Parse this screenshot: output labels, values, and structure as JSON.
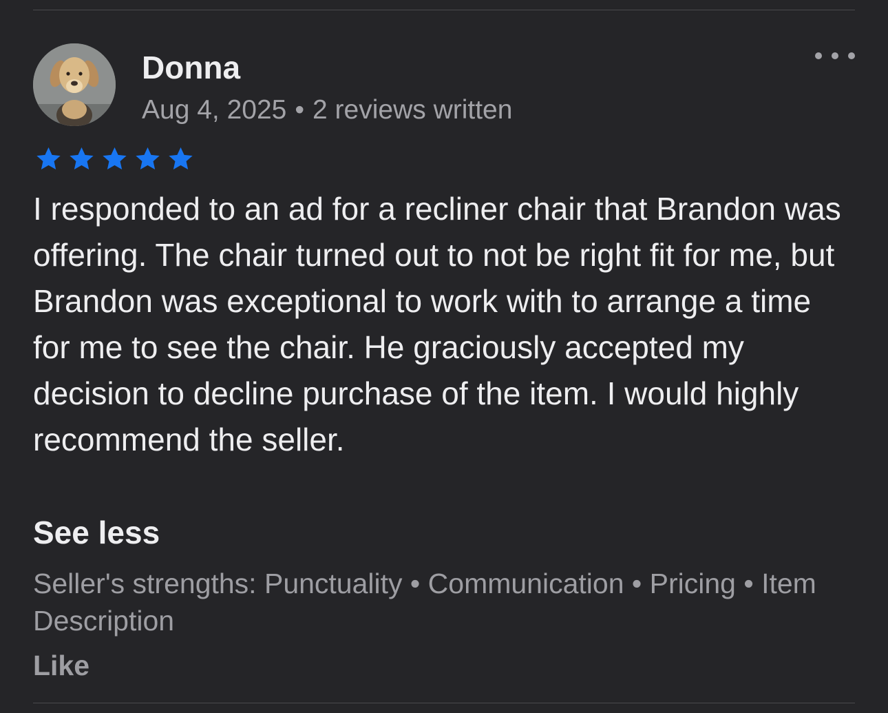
{
  "review": {
    "reviewer_name": "Donna",
    "date": "Aug 4, 2025",
    "separator": "•",
    "reviews_written": "2 reviews written",
    "rating": 5,
    "rating_max": 5,
    "star_color": "#1876f2",
    "body": "I responded to an ad for a recliner chair that Brandon was offering. The chair turned out to not be right fit for me, but Brandon was exceptional to work with to arrange a time for me to see the chair. He graciously accepted my decision to decline purchase of the item. I would highly recommend the seller.",
    "see_less_label": "See less",
    "strengths_text": "Seller's strengths: Punctuality • Communication • Pricing • Item Description",
    "like_label": "Like",
    "more_icon": "more-horizontal-icon",
    "avatar_icon": "dog-avatar"
  }
}
